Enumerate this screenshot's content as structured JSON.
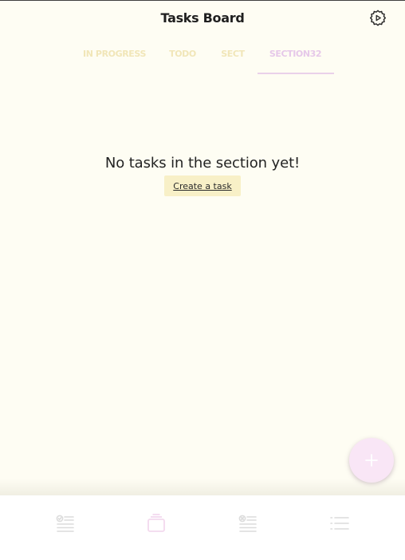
{
  "header": {
    "title": "Tasks Board",
    "settings_icon": "settings-icon"
  },
  "tabs": [
    {
      "label": "IN PROGRESS",
      "active": false
    },
    {
      "label": "TODO",
      "active": false
    },
    {
      "label": "SECT",
      "active": false
    },
    {
      "label": "SECTION32",
      "active": true
    }
  ],
  "main": {
    "empty_message": "No tasks in the section yet!",
    "create_task_label": "Create a task"
  },
  "fab": {
    "icon": "plus-icon",
    "color": "#f9e6f6"
  },
  "bottom_nav": {
    "items": [
      {
        "icon": "checklist-icon",
        "active": false
      },
      {
        "icon": "boards-icon",
        "active": true
      },
      {
        "icon": "cancelled-list-icon",
        "active": false
      },
      {
        "icon": "list-icon",
        "active": false
      }
    ]
  },
  "colors": {
    "background": "#fefdf3",
    "tab_inactive": "#f1e6b8",
    "tab_active": "#e6c8e9",
    "create_button_bg": "#f8f0c7",
    "nav_icon": "#dcdcdc",
    "nav_icon_active": "#f3d9ee"
  }
}
